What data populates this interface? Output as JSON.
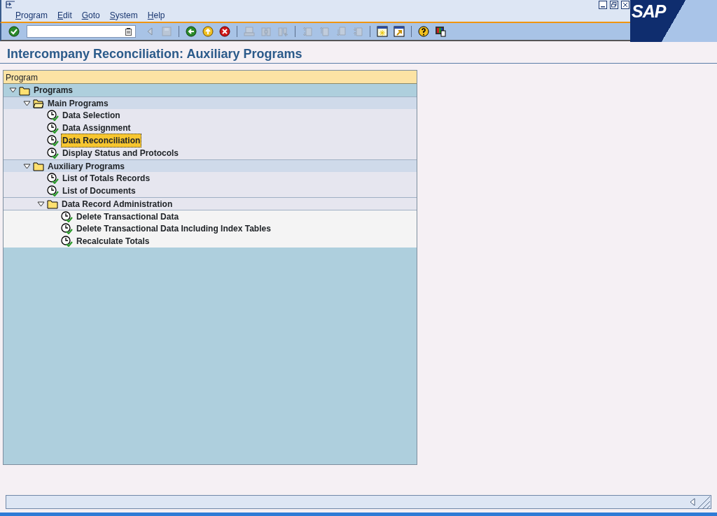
{
  "window": {
    "logo": "SAP"
  },
  "menu": [
    {
      "label": "Program"
    },
    {
      "label": "Edit"
    },
    {
      "label": "Goto"
    },
    {
      "label": "System"
    },
    {
      "label": "Help"
    }
  ],
  "toolbar": [
    {
      "kind": "enter",
      "disabled": false
    },
    {
      "kind": "command"
    },
    {
      "kind": "prev",
      "disabled": true
    },
    {
      "kind": "save",
      "disabled": true
    },
    {
      "kind": "sep"
    },
    {
      "kind": "back",
      "disabled": false
    },
    {
      "kind": "exit",
      "disabled": false
    },
    {
      "kind": "cancel",
      "disabled": false
    },
    {
      "kind": "sep"
    },
    {
      "kind": "print",
      "disabled": true
    },
    {
      "kind": "find",
      "disabled": true
    },
    {
      "kind": "findnext",
      "disabled": true
    },
    {
      "kind": "sep"
    },
    {
      "kind": "first",
      "disabled": true
    },
    {
      "kind": "up",
      "disabled": true
    },
    {
      "kind": "down",
      "disabled": true
    },
    {
      "kind": "last",
      "disabled": true
    },
    {
      "kind": "sep"
    },
    {
      "kind": "session",
      "disabled": false
    },
    {
      "kind": "shortcut",
      "disabled": false
    },
    {
      "kind": "sep"
    },
    {
      "kind": "help",
      "disabled": false
    },
    {
      "kind": "layout",
      "disabled": false
    }
  ],
  "title": "Intercompany Reconciliation: Auxiliary Programs",
  "tree": {
    "header": "Program",
    "nodes": [
      {
        "label": "Programs",
        "kind": "folder",
        "expanded": true,
        "children": [
          {
            "label": "Main Programs",
            "kind": "open_folder",
            "expanded": true,
            "children": [
              {
                "label": "Data Selection",
                "kind": "program",
                "selected": false
              },
              {
                "label": "Data Assignment",
                "kind": "program",
                "selected": false
              },
              {
                "label": "Data Reconciliation",
                "kind": "program",
                "selected": true
              },
              {
                "label": "Display Status and Protocols",
                "kind": "program",
                "selected": false
              }
            ]
          },
          {
            "label": "Auxiliary Programs",
            "kind": "folder",
            "expanded": true,
            "children": [
              {
                "label": "List of Totals Records",
                "kind": "program",
                "selected": false
              },
              {
                "label": "List of Documents",
                "kind": "program",
                "selected": false
              },
              {
                "label": "Data Record Administration",
                "kind": "folder",
                "expanded": true,
                "children": [
                  {
                    "label": "Delete Transactional Data",
                    "kind": "program",
                    "selected": false
                  },
                  {
                    "label": "Delete Transactional Data Including Index Tables",
                    "kind": "program",
                    "selected": false
                  },
                  {
                    "label": "Recalculate Totals",
                    "kind": "program",
                    "selected": false
                  }
                ]
              }
            ]
          }
        ]
      }
    ]
  }
}
